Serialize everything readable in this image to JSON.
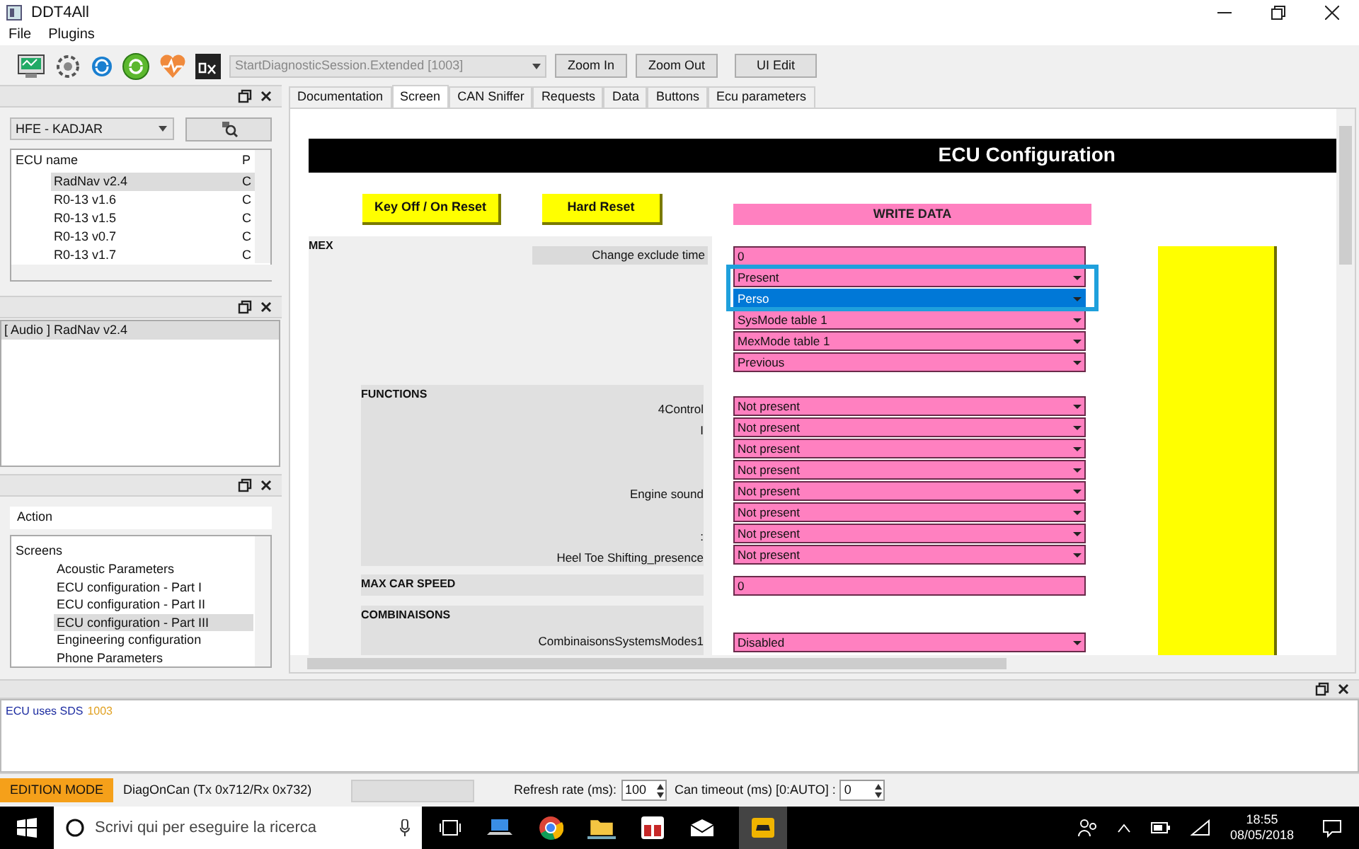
{
  "window": {
    "title": "DDT4All"
  },
  "menu": [
    "File",
    "Plugins"
  ],
  "toolbar": {
    "session": "StartDiagnosticSession.Extended [1003]",
    "buttons": [
      "Zoom In",
      "Zoom Out",
      "UI Edit"
    ]
  },
  "vehicle_select": {
    "value": "HFE - KADJAR"
  },
  "ecu_table": {
    "columns": [
      "ECU name",
      "P"
    ],
    "rows": [
      {
        "name": "RadNav v2.4",
        "column_2": "C",
        "selected": true
      },
      {
        "name": "R0-13 v1.6",
        "column_2": "C",
        "selected": false
      },
      {
        "name": "R0-13 v1.5",
        "column_2": "C",
        "selected": false
      },
      {
        "name": "R0-13 v0.7",
        "column_2": "C",
        "selected": false
      },
      {
        "name": "R0-13 v1.7",
        "column_2": "C",
        "selected": false
      }
    ]
  },
  "ecu_list": [
    {
      "label": "[ Audio ] RadNav v2.4",
      "selected": true
    }
  ],
  "action_field": {
    "value": "Action"
  },
  "screens_tree": {
    "label": "Screens",
    "children": [
      {
        "label": "Acoustic Parameters",
        "selected": false
      },
      {
        "label": "ECU configuration - Part I",
        "selected": false
      },
      {
        "label": "ECU configuration - Part II",
        "selected": false
      },
      {
        "label": "ECU configuration - Part III",
        "selected": true
      },
      {
        "label": "Engineering configuration",
        "selected": false
      },
      {
        "label": "Phone Parameters",
        "selected": false
      }
    ]
  },
  "tabs": [
    {
      "label": "Documentation",
      "selected": false
    },
    {
      "label": "Screen",
      "selected": true
    },
    {
      "label": "CAN Sniffer",
      "selected": false
    },
    {
      "label": "Requests",
      "selected": false
    },
    {
      "label": "Data",
      "selected": false
    },
    {
      "label": "Buttons",
      "selected": false
    },
    {
      "label": "Ecu parameters",
      "selected": false
    }
  ],
  "ecu_screen": {
    "title": "ECU Configuration",
    "buttons": [
      "Key Off / On Reset",
      "Hard Reset"
    ],
    "write_data": "WRITE DATA",
    "sections": [
      {
        "title": "MEX",
        "rows": [
          {
            "label": "Change exclude time",
            "value": "0",
            "kind": "text",
            "selected": false
          },
          {
            "value": "Present",
            "kind": "combo",
            "selected": false
          },
          {
            "value": "Perso",
            "kind": "combo",
            "selected": true
          },
          {
            "value": "SysMode table 1",
            "kind": "combo",
            "selected": false
          },
          {
            "value": "MexMode table 1",
            "kind": "combo",
            "selected": false
          },
          {
            "value": "Previous",
            "kind": "combo",
            "selected": false
          }
        ]
      },
      {
        "title": "FUNCTIONS",
        "rows": [
          {
            "label": "4Control",
            "value": "Not present",
            "kind": "combo",
            "selected": false
          },
          {
            "label": "I",
            "value": "Not present",
            "kind": "combo",
            "selected": false
          },
          {
            "value": "Not present",
            "kind": "combo",
            "selected": false
          },
          {
            "value": "Not present",
            "kind": "combo",
            "selected": false
          },
          {
            "label": "Engine sound",
            "value": "Not present",
            "kind": "combo",
            "selected": false
          },
          {
            "value": "Not present",
            "kind": "combo",
            "selected": false
          },
          {
            "label": ":",
            "value": "Not present",
            "kind": "combo",
            "selected": false
          },
          {
            "label": "Heel Toe Shifting_presence",
            "value": "Not present",
            "kind": "combo",
            "selected": false
          }
        ]
      },
      {
        "title": "MAX CAR SPEED",
        "rows": [
          {
            "value": "0",
            "kind": "text",
            "selected": false
          }
        ]
      },
      {
        "title": "COMBINAISONS",
        "rows": [
          {
            "label": "CombinaisonsSystemsModes1",
            "value": "Disabled",
            "kind": "combo",
            "selected": false
          }
        ]
      }
    ]
  },
  "log": [
    {
      "message": "ECU uses SDS",
      "code": "1003"
    }
  ],
  "status_bar": {
    "mode": "EDITION MODE",
    "protocol": "DiagOnCan (Tx 0x712/Rx 0x732)",
    "refresh_label": "Refresh rate (ms):",
    "refresh_value": "100",
    "timeout_label": "Can timeout (ms) [0:AUTO] :",
    "timeout_value": "0"
  },
  "taskbar": {
    "search_placeholder": "Scrivi qui per eseguire la ricerca",
    "time": "18:55",
    "date": "08/05/2018"
  }
}
